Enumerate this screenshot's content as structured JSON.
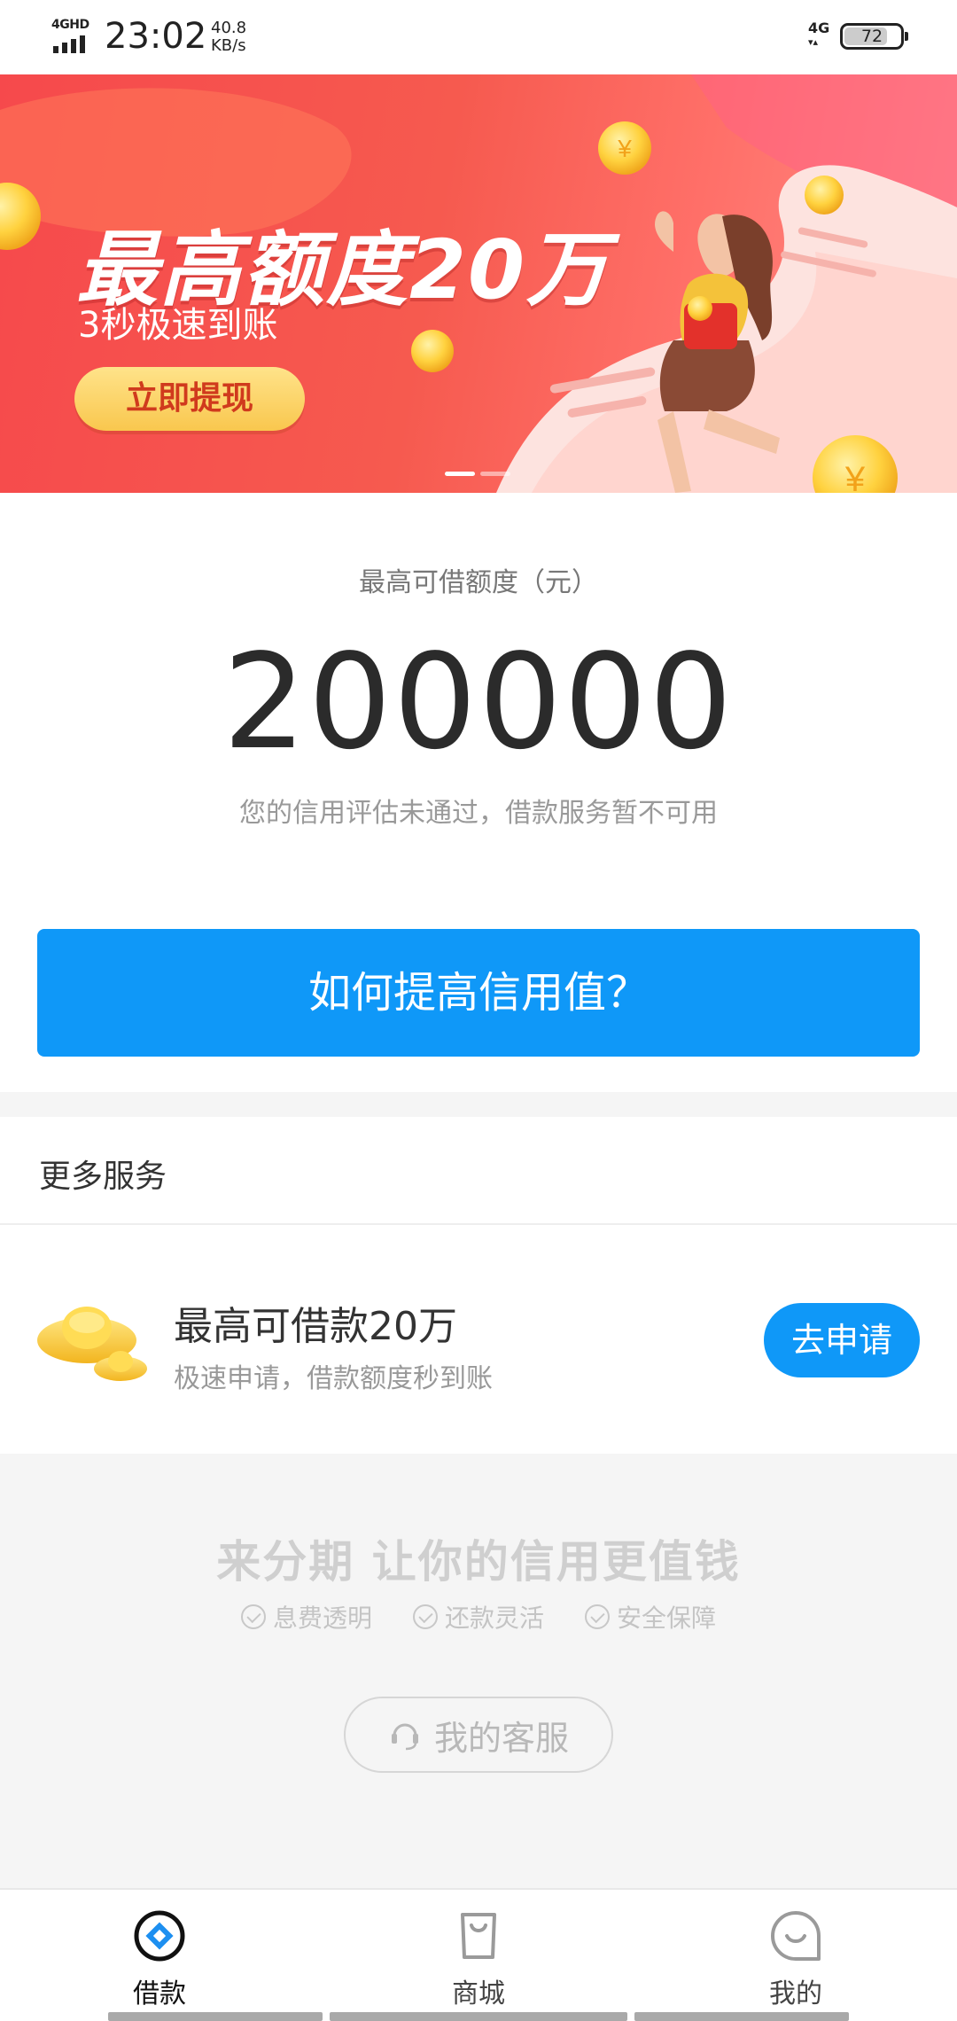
{
  "status_bar": {
    "network": "4GHD",
    "time": "23:02",
    "speed_value": "40.8",
    "speed_unit": "KB/s",
    "right_network": "4G",
    "battery": "72"
  },
  "banner": {
    "title": "最高额度20万",
    "subtitle": "3秒极速到账",
    "cta": "立即提现",
    "slide_count": 2,
    "active_slide": 1
  },
  "credit": {
    "label": "最高可借额度（元）",
    "amount": "200000",
    "note": "您的信用评估未通过，借款服务暂不可用",
    "button": "如何提高信用值？"
  },
  "more_services": {
    "title": "更多服务",
    "item": {
      "icon": "gold-ingot-icon",
      "title": "最高可借款20万",
      "desc": "极速申请，借款额度秒到账",
      "button": "去申请"
    }
  },
  "footer": {
    "slogan": "来分期  让你的信用更值钱",
    "features": [
      "息费透明",
      "还款灵活",
      "安全保障"
    ],
    "service_button": "我的客服"
  },
  "bottom_nav": {
    "items": [
      {
        "label": "借款",
        "icon": "loan-icon",
        "active": true
      },
      {
        "label": "商城",
        "icon": "shop-bag-icon",
        "active": false
      },
      {
        "label": "我的",
        "icon": "profile-face-icon",
        "active": false
      }
    ]
  },
  "colors": {
    "accent": "#0f98f8",
    "banner_red": "#f6494c",
    "gold": "#f9c74e"
  }
}
